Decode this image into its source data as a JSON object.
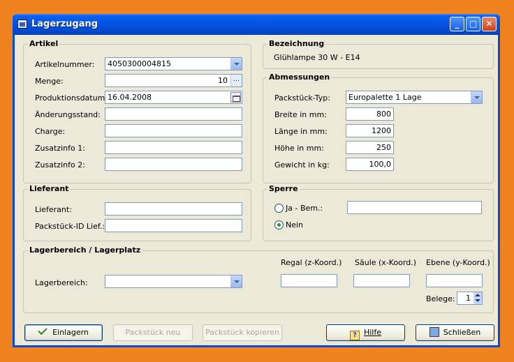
{
  "window": {
    "title": "Lagerzugang"
  },
  "artikel": {
    "legend": "Artikel",
    "artikelnummer_label": "Artikelnummer:",
    "artikelnummer_value": "4050300004815",
    "menge_label": "Menge:",
    "menge_value": "10",
    "menge_button": "...",
    "produktionsdatum_label": "Produktionsdatum:",
    "produktionsdatum_value": "16.04.2008",
    "aenderungsstand_label": "Änderungsstand:",
    "aenderungsstand_value": "",
    "charge_label": "Charge:",
    "charge_value": "",
    "zusatzinfo1_label": "Zusatzinfo 1:",
    "zusatzinfo1_value": "",
    "zusatzinfo2_label": "Zusatzinfo 2:",
    "zusatzinfo2_value": ""
  },
  "bezeichnung": {
    "legend": "Bezeichnung",
    "value": "Glühlampe 30 W - E14"
  },
  "abmessungen": {
    "legend": "Abmessungen",
    "packstueck_typ_label": "Packstück-Typ:",
    "packstueck_typ_value": "Europalette 1 Lage",
    "breite_label": "Breite in mm:",
    "breite_value": "800",
    "laenge_label": "Länge in mm:",
    "laenge_value": "1200",
    "hoehe_label": "Höhe in mm:",
    "hoehe_value": "250",
    "gewicht_label": "Gewicht in kg:",
    "gewicht_value": "100,0"
  },
  "lieferant": {
    "legend": "Lieferant",
    "lieferant_label": "Lieferant:",
    "lieferant_value": "",
    "packstueck_id_label": "Packstück-ID Lief.:",
    "packstueck_id_value": ""
  },
  "sperre": {
    "legend": "Sperre",
    "ja_label": "Ja -  Bem.:",
    "bem_value": "",
    "nein_label": "Nein",
    "selected": "Nein"
  },
  "lagerbereich": {
    "legend": "Lagerbereich / Lagerplatz",
    "lagerbereich_label": "Lagerbereich:",
    "lagerbereich_value": "",
    "regal_label": "Regal (z-Koord.)",
    "regal_value": "",
    "saeule_label": "Säule (x-Koord.)",
    "saeule_value": "",
    "ebene_label": "Ebene (y-Koord.)",
    "ebene_value": "",
    "belege_label": "Belege:",
    "belege_value": "1"
  },
  "buttons": {
    "einlagern": "Einlagern",
    "packstueck_neu": "Packstück neu",
    "packstueck_kopieren": "Packstück kopieren",
    "hilfe": "Hilfe",
    "schliessen": "Schließen"
  }
}
